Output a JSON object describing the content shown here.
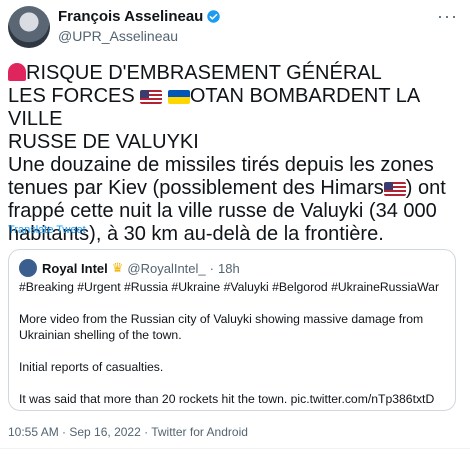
{
  "author": {
    "name": "François Asselineau",
    "handle": "@UPR_Asselineau",
    "verified_color": "#1d9bf0"
  },
  "tweet": {
    "line1": "RISQUE D'EMBRASEMENT GÉNÉRAL",
    "line2_a": "LES FORCES ",
    "line2_b": "OTAN BOMBARDENT LA VILLE",
    "line3": "RUSSE DE VALUYKI",
    "body_a": "Une douzaine de missiles tirés depuis les zones tenues par Kiev (possiblement des Himars",
    "body_b": ") ont frappé cette nuit la ville russe de Valuyki (34 000 habitants), à 30 km au-delà de la frontière.",
    "translate_label": "Translate Tweet"
  },
  "quote": {
    "name": "Royal Intel",
    "handle": "@RoyalIntel_",
    "time": "18h",
    "separator": "·",
    "text": "#Breaking #Urgent #Russia #Ukraine #Valuyki #Belgorod #UkraineRussiaWar\n\nMore video from the Russian city of Valuyki showing massive damage from Ukrainian shelling of the town.\n\nInitial reports of casualties.\n\nIt was said that more than 20 rockets hit the town. pic.twitter.com/nTp386txtD"
  },
  "meta": {
    "line": "10:55 AM · Sep 16, 2022 · Twitter for Android"
  },
  "icons": [
    "siren-icon",
    "us-flag-icon",
    "ukraine-flag-icon",
    "verified-badge-icon",
    "more-options-icon",
    "crown-icon"
  ]
}
